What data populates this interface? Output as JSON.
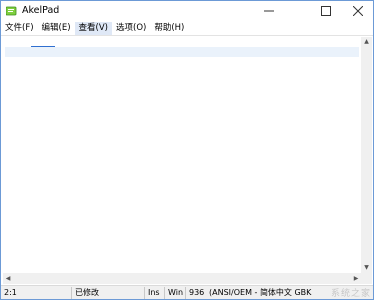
{
  "window": {
    "title": "AkelPad"
  },
  "menu": {
    "items": [
      {
        "label": "文件(F)"
      },
      {
        "label": "编辑(E)"
      },
      {
        "label": "查看(V)"
      },
      {
        "label": "选项(O)"
      },
      {
        "label": "帮助(H)"
      }
    ]
  },
  "status": {
    "position": "2:1",
    "modified": "已修改",
    "insert_mode": "Ins",
    "newline": "Win",
    "codepage": "936",
    "encoding": "(ANSI/OEM - 简体中文 GBK",
    "watermark": "系统之家"
  },
  "colors": {
    "accent": "#2f6fd0",
    "active_line": "#eaf2fb",
    "menu_active": "#dfe8f6"
  }
}
